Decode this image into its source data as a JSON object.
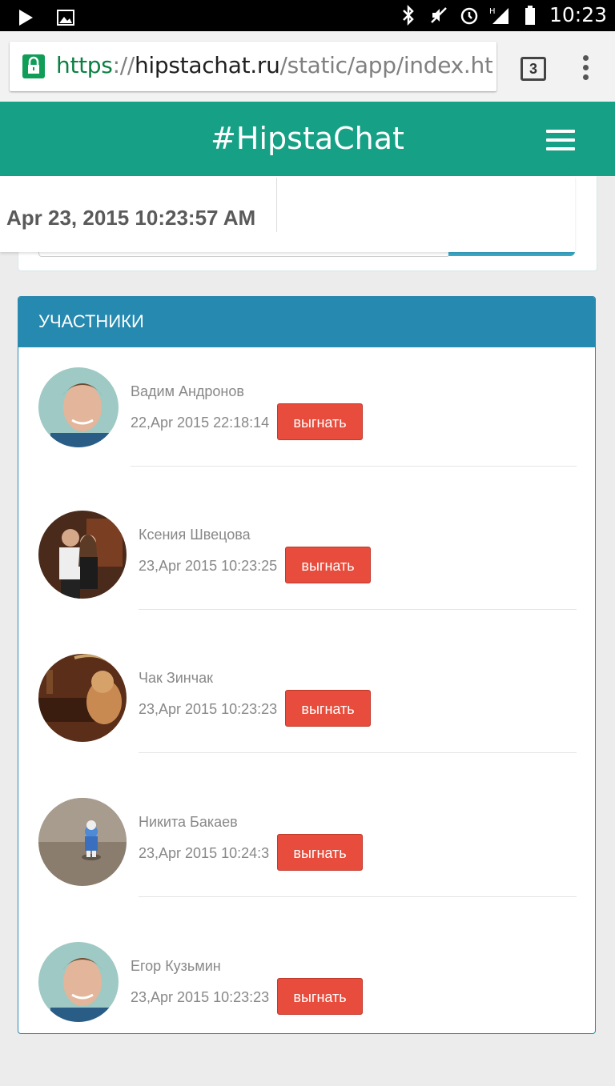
{
  "statusbar": {
    "time": "10:23"
  },
  "browser": {
    "url_scheme": "https",
    "url_sep": "://",
    "url_host": "hipstachat.ru",
    "url_path": "/static/app/index.html#",
    "tab_count": "3"
  },
  "app": {
    "title": "#HipstaChat"
  },
  "datetime_popup": {
    "value": "Apr 23, 2015 10:23:57 AM"
  },
  "participants": {
    "title": "УЧАСТНИКИ",
    "kick_label": "выгнать",
    "members": [
      {
        "name": "Вадим Андронов",
        "date": "22,Apr 2015 22:18:14"
      },
      {
        "name": "Ксения Швецова",
        "date": "23,Apr 2015 10:23:25"
      },
      {
        "name": "Чак Зинчак",
        "date": "23,Apr 2015 10:23:23"
      },
      {
        "name": "Никита Бакаев",
        "date": "23,Apr 2015 10:24:3"
      },
      {
        "name": "Егор Кузьмин",
        "date": "23,Apr 2015 10:23:23"
      }
    ]
  },
  "colors": {
    "header": "#16a085",
    "panel_header": "#2589b0",
    "kick_button": "#e74c3c"
  }
}
